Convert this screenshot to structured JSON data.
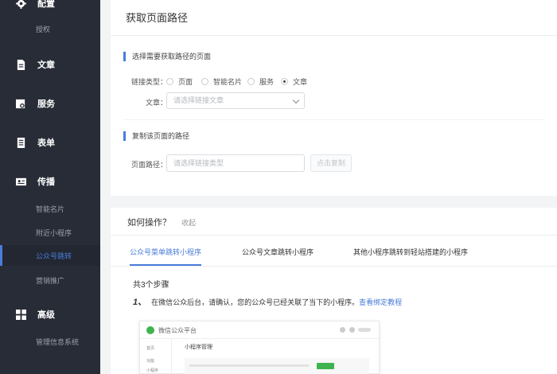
{
  "sidebar": {
    "items": [
      {
        "label": "配置",
        "icon": "gear-icon"
      },
      {
        "label": "授权"
      },
      {
        "label": "文章",
        "icon": "document-icon"
      },
      {
        "label": "服务",
        "icon": "service-icon"
      },
      {
        "label": "表单",
        "icon": "form-icon"
      },
      {
        "label": "传播",
        "icon": "id-card-icon"
      },
      {
        "label": "智能名片"
      },
      {
        "label": "附近小程序"
      },
      {
        "label": "公众号跳转",
        "active": true
      },
      {
        "label": "营销推广"
      },
      {
        "label": "高级",
        "icon": "grid-icon"
      },
      {
        "label": "管理信息系统"
      }
    ]
  },
  "top": {
    "title": "获取页面路径",
    "section1": "选择需要获取路径的页面",
    "link_type_label": "链接类型：",
    "link_types": [
      "页面",
      "智能名片",
      "服务",
      "文章"
    ],
    "selected_type": "文章",
    "article_label": "文章：",
    "article_placeholder": "请选择链接文章",
    "section2": "复制该页面的路径",
    "path_label": "页面路径：",
    "path_placeholder": "请选择链接类型",
    "copy_button": "点击复制"
  },
  "how": {
    "title": "如何操作？",
    "collapse": "收起",
    "tabs": [
      "公众号菜单跳转小程序",
      "公众号文章跳转小程序",
      "其他小程序跳转到轻站搭建的小程序"
    ],
    "active_tab": 0,
    "steps_count": "共3个步骤",
    "step1_num": "1、",
    "step1_text": "在微信公众后台，请确认，您的公众号已经关联了当下的小程序。",
    "step1_link": "查看绑定教程",
    "screenshot": {
      "header": "微信公众平台",
      "side_items": [
        "首页",
        "功能",
        "小程序"
      ],
      "main_title": "小程序管理"
    }
  },
  "colors": {
    "sidebar_bg": "#272c36",
    "accent": "#4a7bd8",
    "wechat_green": "#3fb34f"
  }
}
